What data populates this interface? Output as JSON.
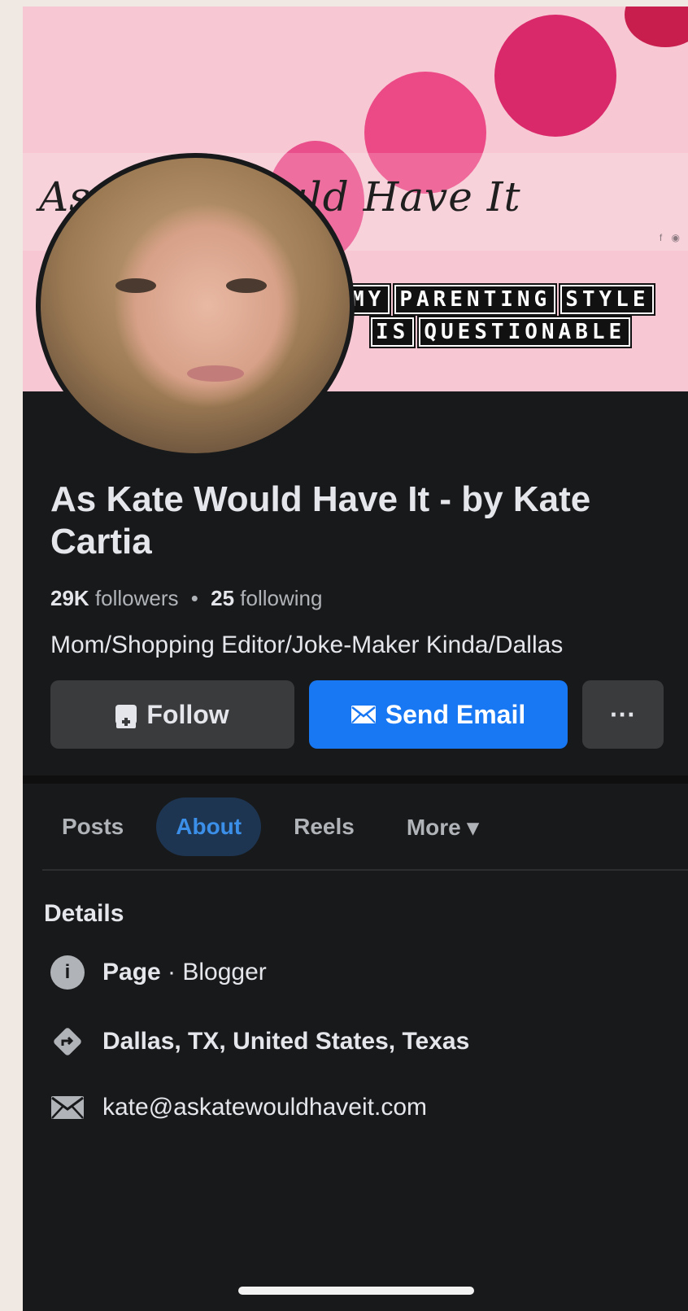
{
  "cover": {
    "script_title": "As Kate Would Have It",
    "social_icons": "f  ◉",
    "stamp_lines": [
      [
        "MY",
        "PARENTING",
        "STYLE"
      ],
      [
        "IS",
        "QUESTIONABLE"
      ]
    ]
  },
  "profile": {
    "name": "As Kate Would Have It - by Kate Cartia",
    "followers_count": "29K",
    "followers_label": "followers",
    "dot": "•",
    "following_count": "25",
    "following_label": "following",
    "bio": "Mom/Shopping Editor/Joke-Maker Kinda/Dallas"
  },
  "actions": {
    "follow_label": "Follow",
    "email_label": "Send Email",
    "more_label": "···"
  },
  "tabs": [
    {
      "label": "Posts",
      "active": false
    },
    {
      "label": "About",
      "active": true
    },
    {
      "label": "Reels",
      "active": false
    },
    {
      "label": "More ▾",
      "active": false
    }
  ],
  "details": {
    "heading": "Details",
    "page_type_bold": "Page",
    "page_type_rest": " · Blogger",
    "location": "Dallas, TX, United States, Texas",
    "email": "kate@askatewouldhaveit.com"
  },
  "colors": {
    "accent": "#1877f2",
    "background": "#18191a",
    "cover_pink": "#f7c8d3"
  }
}
